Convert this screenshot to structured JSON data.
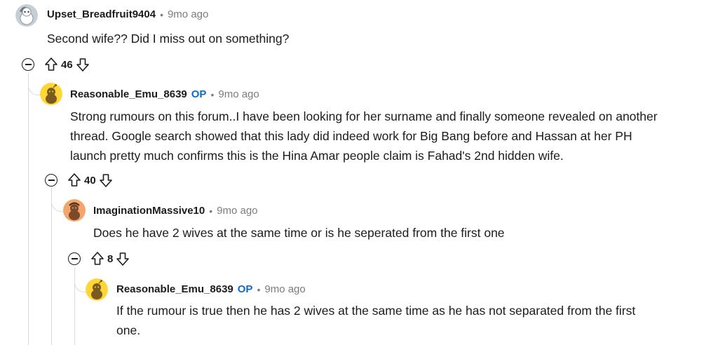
{
  "comments": [
    {
      "author": "Upset_Breadfruit9404",
      "separator": "•",
      "time": "9mo ago",
      "body": [
        "Second wife?? Did I miss out on something?"
      ],
      "votes": "46",
      "avatar_color": "#c7cfd6"
    },
    {
      "author": "Reasonable_Emu_8639",
      "op_badge": "OP",
      "separator": "•",
      "time": "9mo ago",
      "body": [
        "Strong rumours on this forum..I have been looking for her surname and finally someone revealed on another",
        "thread. Google search showed that this lady did indeed work for Big Bang before and Hassan at her PH",
        "launch pretty much confirms this is the Hina Amar people claim is Fahad's 2nd hidden wife."
      ],
      "votes": "40",
      "avatar_color": "#ffd635"
    },
    {
      "author": "ImaginationMassive10",
      "separator": "•",
      "time": "9mo ago",
      "body": [
        "Does he have 2 wives at the same time or is he seperated from the first one"
      ],
      "votes": "8",
      "avatar_color": "#f3a56b"
    },
    {
      "author": "Reasonable_Emu_8639",
      "op_badge": "OP",
      "separator": "•",
      "time": "9mo ago",
      "body": [
        "If the rumour is true then he has 2 wives at the same time as he has not separated from the first",
        "one."
      ],
      "avatar_color": "#ffd635"
    }
  ],
  "colors": {
    "op": "#0a6bcd",
    "meta": "#7c7c7c",
    "thread_line": "#dadada"
  },
  "icons": [
    "collapse-icon",
    "upvote-icon",
    "downvote-icon",
    "snoo-avatar-icon"
  ]
}
